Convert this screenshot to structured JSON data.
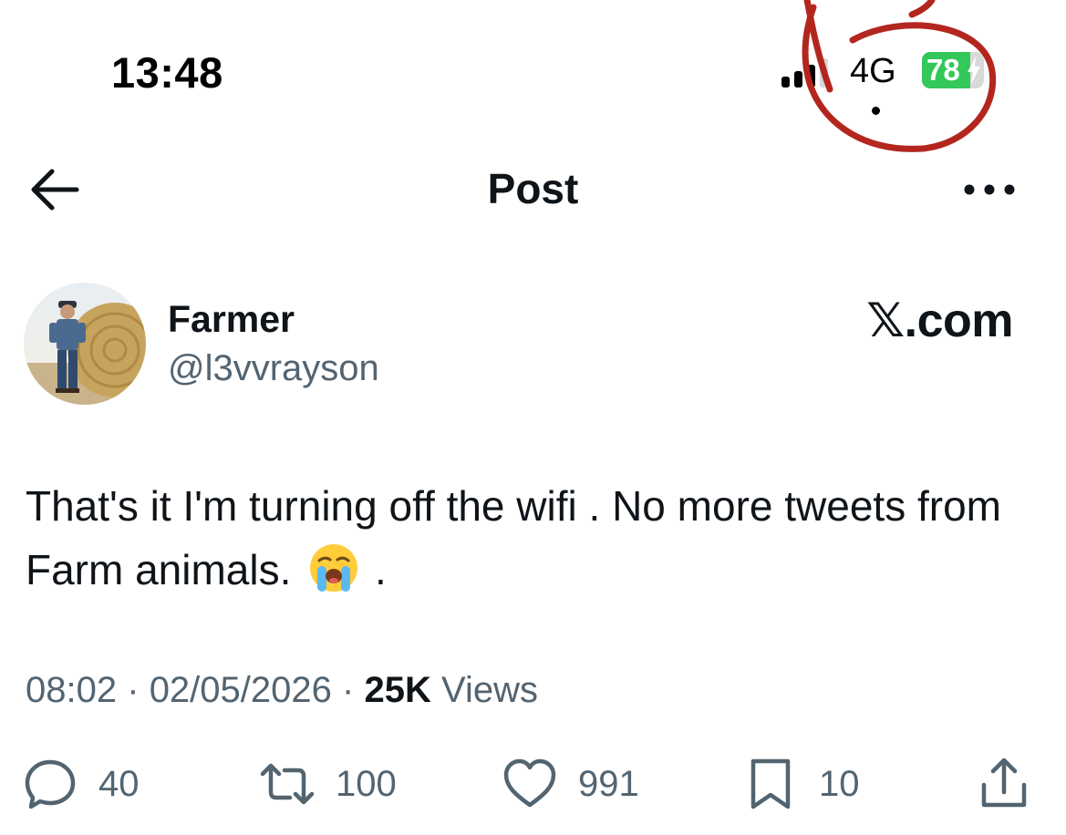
{
  "status_bar": {
    "time": "13:48",
    "network": "4G",
    "battery_percent": "78",
    "battery_level": 0.78,
    "battery_color": "#34c759",
    "charging": true,
    "annotation_color": "#b3261e"
  },
  "header": {
    "title": "Post",
    "back_icon": "arrow-left-icon",
    "more_icon": "more-horizontal-icon"
  },
  "author": {
    "display_name": "Farmer",
    "handle": "@l3vvrayson",
    "avatar_icon": "avatar-farmer-hay-bale"
  },
  "watermark": "𝕏.com",
  "tweet": {
    "text": "That's it I'm turning off the wifi . No more tweets from Farm animals.",
    "emoji": "😭",
    "trailing": "."
  },
  "meta": {
    "time": "08:02",
    "separator": "·",
    "date": "02/05/2026",
    "views_count": "25K",
    "views_label": "Views"
  },
  "actions": {
    "reply": {
      "icon": "reply-icon",
      "count": "40"
    },
    "repost": {
      "icon": "repost-icon",
      "count": "100"
    },
    "like": {
      "icon": "heart-icon",
      "count": "991"
    },
    "bookmark": {
      "icon": "bookmark-icon",
      "count": "10"
    },
    "share": {
      "icon": "share-icon"
    }
  },
  "colors": {
    "text_primary": "#0f1419",
    "text_secondary": "#536471"
  }
}
